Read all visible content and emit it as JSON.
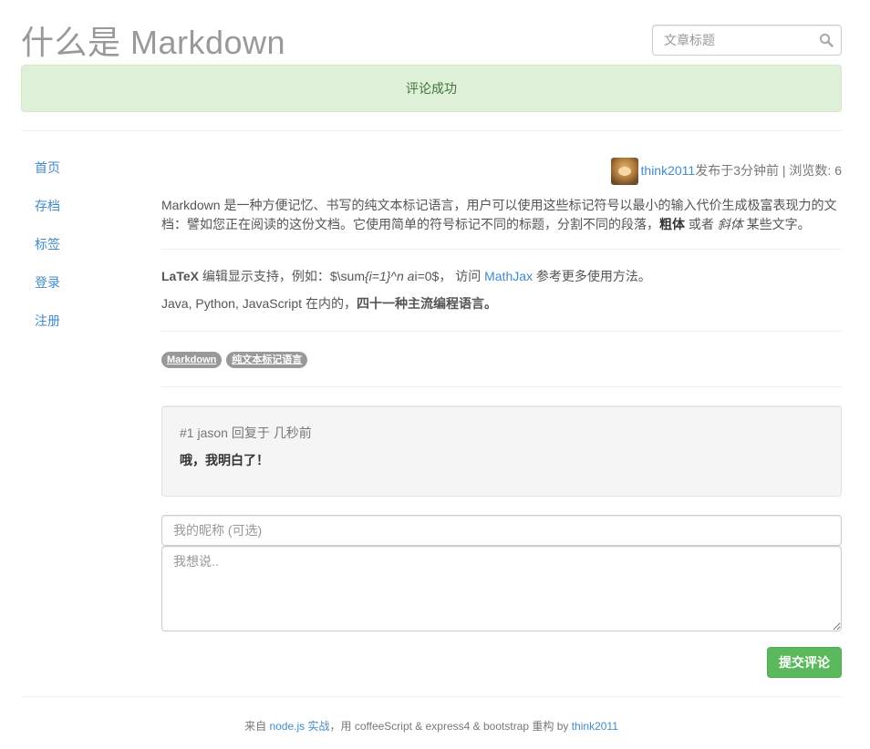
{
  "header": {
    "title": "什么是 Markdown",
    "search_placeholder": "文章标题"
  },
  "alert": {
    "text": "评论成功"
  },
  "sidebar": {
    "items": [
      {
        "label": "首页"
      },
      {
        "label": "存档"
      },
      {
        "label": "标签"
      },
      {
        "label": "登录"
      },
      {
        "label": "注册"
      }
    ]
  },
  "post": {
    "author": "think2011",
    "published": "发布于3分钟前",
    "views_label": "浏览数:",
    "views": "6",
    "intro_1": "Markdown 是一种方便记忆、书写的纯文本标记语言，用户可以使用这些标记符号以最小的输入代价生成极富表现力的文档：譬如您正在阅读的这份文档。它使用简单的符号标记不同的标题，分割不同的段落，",
    "intro_bold": "粗体",
    "intro_mid": " 或者 ",
    "intro_italic": "斜体",
    "intro_end": " 某些文字。",
    "latex_bold": "LaTeX",
    "latex_text": " 编辑显示支持，例如：$\\sum",
    "latex_italic_1": "{i=1}^n a",
    "latex_text_2": "i=0$， 访问 ",
    "mathjax": "MathJax",
    "latex_end": " 参考更多使用方法。",
    "langs_text": "Java, Python, JavaScript 在内的，",
    "langs_bold": "四十一种主流编程语言。",
    "tags": [
      "Markdown",
      "纯文本标记语言"
    ]
  },
  "comment": {
    "number": "#1",
    "author": "jason",
    "reply_text": "回复于",
    "time": "几秒前",
    "content": "哦，我明白了！"
  },
  "form": {
    "name_placeholder": "我的昵称 (可选)",
    "content_placeholder": "我想说..",
    "submit_label": "提交评论"
  },
  "footer": {
    "prefix": "来自 ",
    "book": "node.js 实战",
    "middle": "，用 coffeeScript & express4 & bootstrap 重构 by ",
    "author": "think2011"
  },
  "colors": {
    "link": "#428bca",
    "success_bg": "#dff0d8",
    "success_text": "#3c763d",
    "button": "#5cb85c",
    "tag": "#999999"
  }
}
